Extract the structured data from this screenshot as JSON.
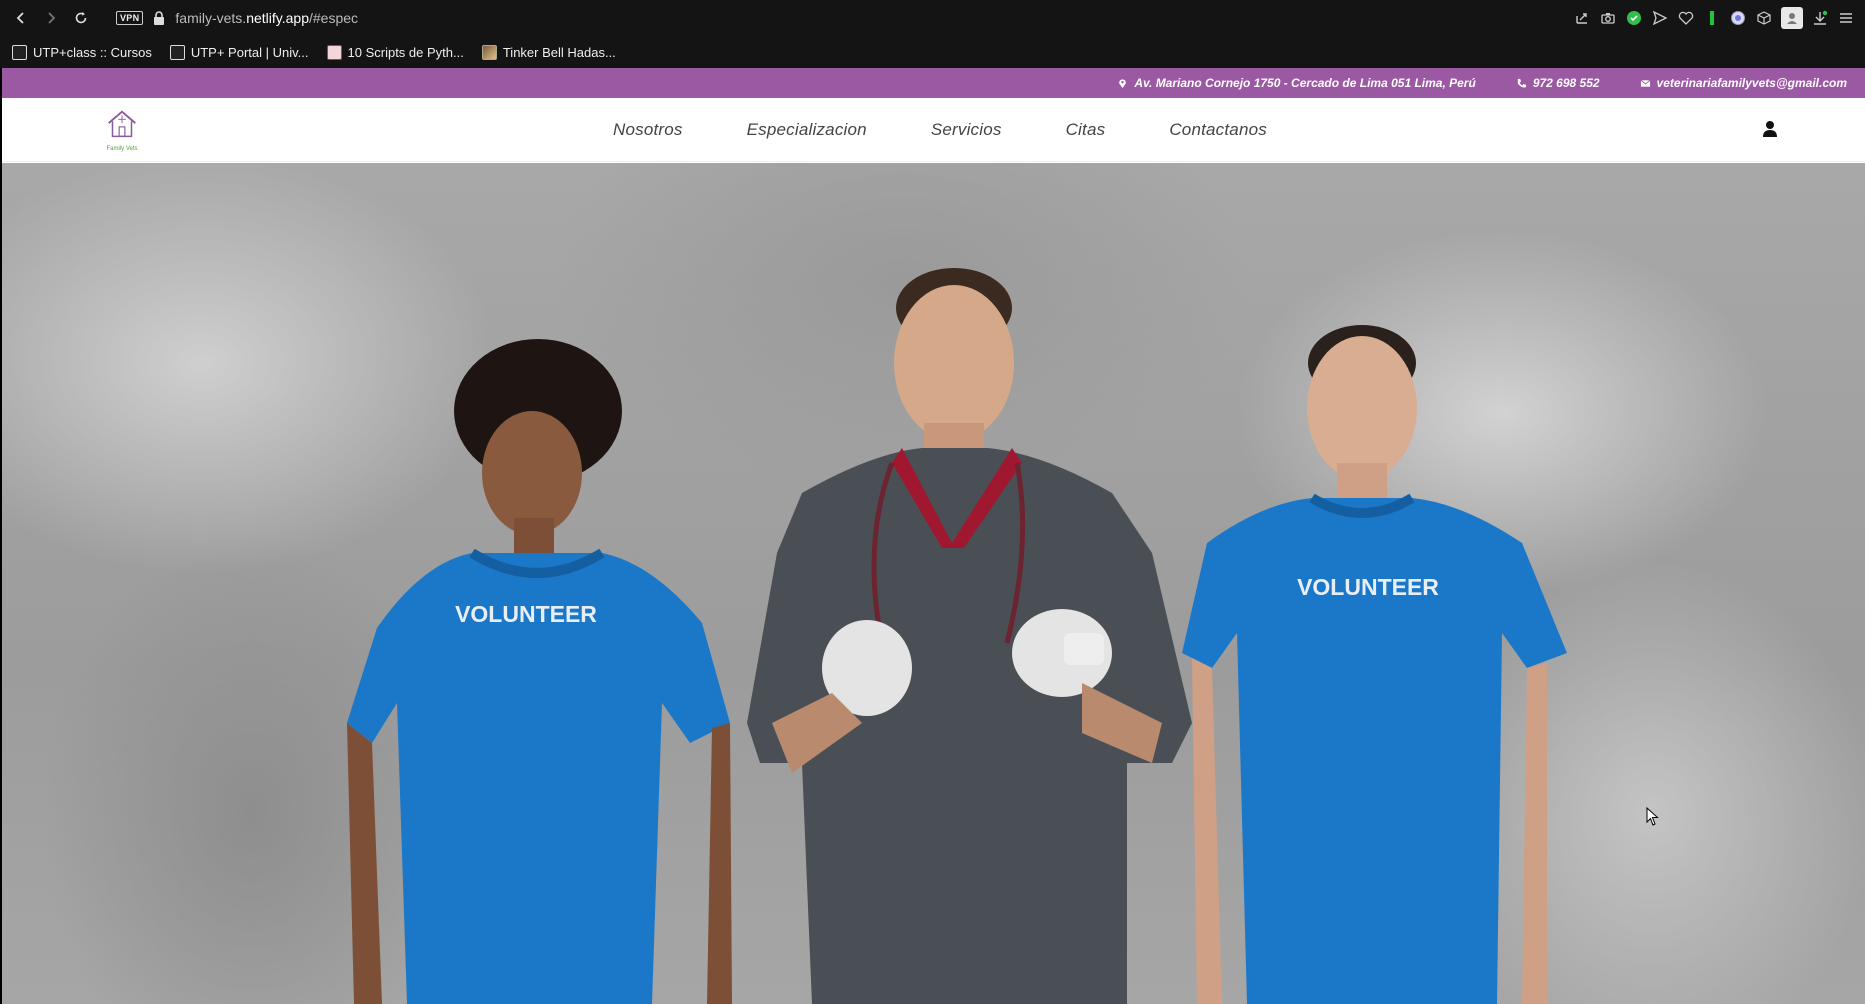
{
  "browser": {
    "url_host": "family-vets.",
    "url_domain": "netlify.app",
    "url_path": "/#espec",
    "vpn_label": "VPN",
    "bookmarks": [
      {
        "label": "UTP+class :: Cursos"
      },
      {
        "label": "UTP+ Portal | Univ..."
      },
      {
        "label": "10 Scripts de Pyth..."
      },
      {
        "label": "Tinker Bell Hadas..."
      }
    ]
  },
  "topbar": {
    "address": "Av. Mariano Cornejo 1750 - Cercado de Lima 051 Lima, Perú",
    "phone": "972 698 552",
    "email": "veterinariafamilyvets@gmail.com",
    "color": "#9b58a3"
  },
  "header": {
    "logo_text": "Family Vets",
    "menu": [
      {
        "label": "Nosotros"
      },
      {
        "label": "Especializacion"
      },
      {
        "label": "Servicios"
      },
      {
        "label": "Citas"
      },
      {
        "label": "Contactanos"
      }
    ]
  },
  "hero": {
    "shirt_text_left": "VOLUNTEER",
    "shirt_text_right": "VOLUNTEER",
    "shirt_color": "#1b78c8",
    "scrubs_color": "#4a4f55"
  }
}
